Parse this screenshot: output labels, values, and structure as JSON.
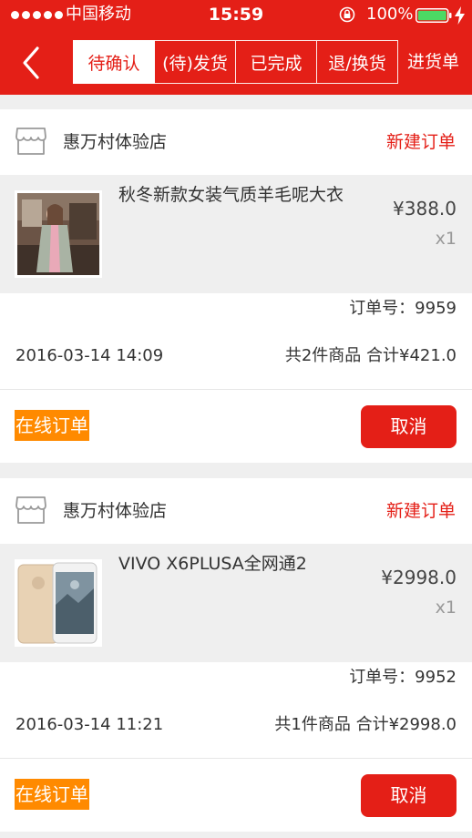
{
  "status_bar": {
    "carrier": "中国移动",
    "time": "15:59",
    "battery": "100%"
  },
  "nav": {
    "back_icon": "chevron-left-icon",
    "tabs": [
      {
        "label": "待确认",
        "active": true
      },
      {
        "label": "(待)发货",
        "active": false
      },
      {
        "label": "已完成",
        "active": false
      },
      {
        "label": "退/换货",
        "active": false
      },
      {
        "label": "进货单",
        "active": false
      }
    ]
  },
  "colors": {
    "brand_red": "#e41f17",
    "badge_orange": "#ff8a00"
  },
  "orders": [
    {
      "store_icon": "store-icon",
      "store_name": "惠万村体验店",
      "status": "新建订单",
      "product_name": "秋冬新款女装气质羊毛呢大衣",
      "price": "¥388.0",
      "qty": "x1",
      "order_no": "订单号：9959",
      "date": "2016-03-14 14:09",
      "total": "共2件商品 合计¥421.0",
      "type": "在线订单",
      "cancel": "取消"
    },
    {
      "store_icon": "store-icon",
      "store_name": "惠万村体验店",
      "status": "新建订单",
      "product_name": "VIVO X6PLUSA全网通2",
      "price": "¥2998.0",
      "qty": "x1",
      "order_no": "订单号：9952",
      "date": "2016-03-14 11:21",
      "total": "共1件商品 合计¥2998.0",
      "type": "在线订单",
      "cancel": "取消"
    }
  ]
}
